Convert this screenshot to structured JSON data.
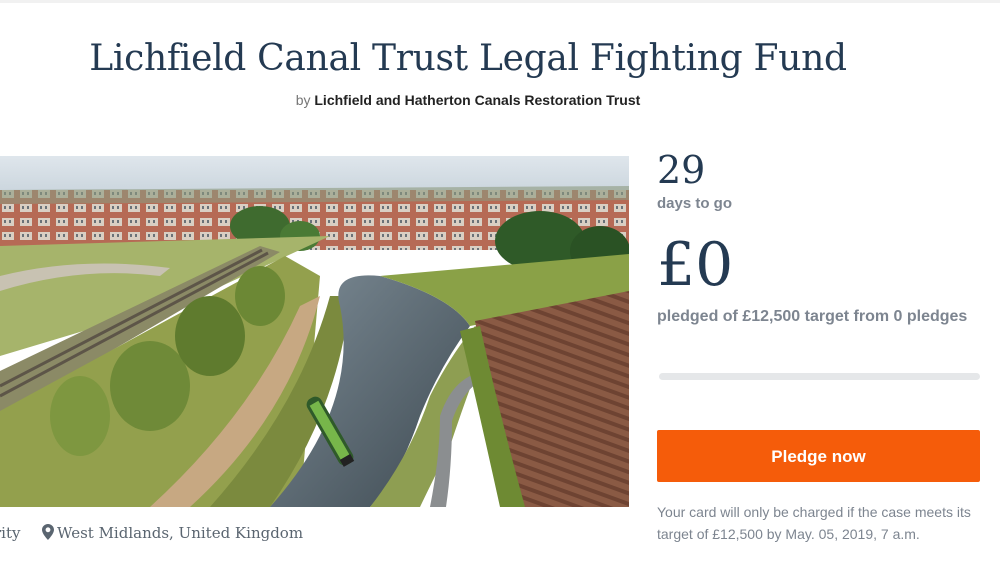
{
  "page": {
    "title": "Lichfield Canal Trust Legal Fighting Fund",
    "by_label": "by",
    "organisation": "Lichfield and Hatherton Canals Restoration Trust"
  },
  "hero": {
    "image_alt": "Aerial illustration of a restored canal with a narrowboat, towpath, houses and fields"
  },
  "meta": {
    "category_partial": "rity",
    "location": "West Midlands, United Kingdom",
    "location_icon": "map-pin-icon"
  },
  "stats": {
    "days_left": "29",
    "days_label": "days to go",
    "pledged_amount": "£0",
    "pledged_label": "pledged of £12,500 target from 0 pledges",
    "progress_fraction": 0
  },
  "actions": {
    "pledge_label": "Pledge now"
  },
  "note": {
    "text": "Your card will only be charged if the case meets its target of £12,500 by May. 05, 2019, 7 a.m."
  },
  "colors": {
    "accent": "#f55c0a",
    "heading": "#243a52",
    "muted": "#7d8590"
  }
}
